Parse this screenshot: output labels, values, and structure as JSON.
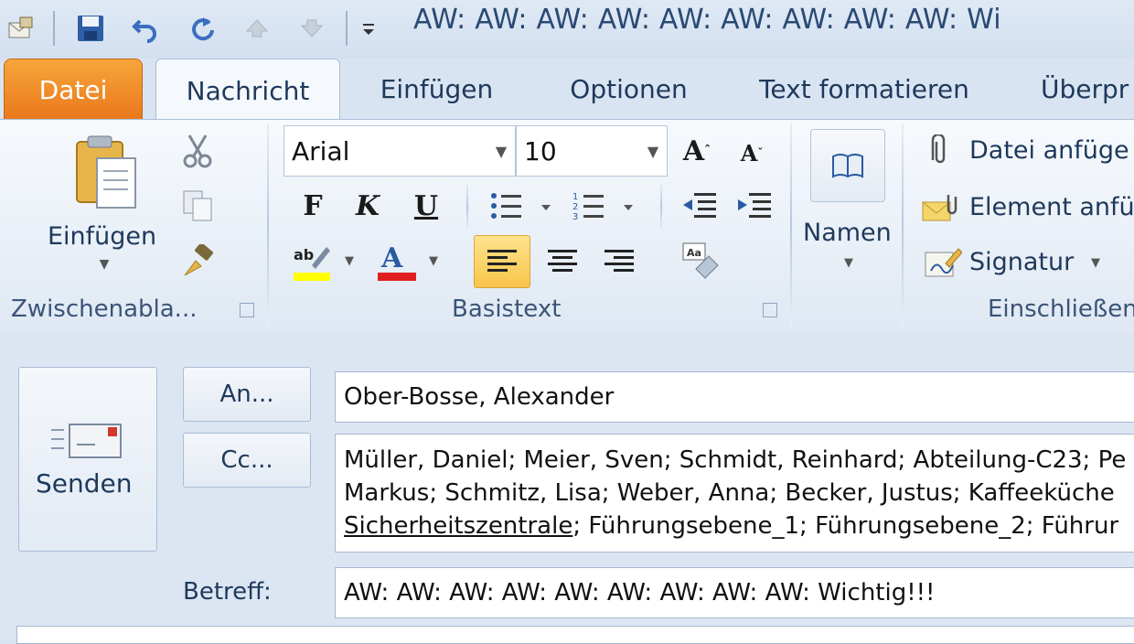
{
  "window": {
    "title": "AW: AW: AW: AW: AW: AW: AW: AW: AW: Wi"
  },
  "quick_access": {
    "icons": [
      "outlook-icon",
      "save-icon",
      "undo-icon",
      "redo-icon",
      "previous-icon",
      "next-icon",
      "customize-toolbar-icon"
    ]
  },
  "tabs": [
    {
      "label": "Datei"
    },
    {
      "label": "Nachricht"
    },
    {
      "label": "Einfügen"
    },
    {
      "label": "Optionen"
    },
    {
      "label": "Text formatieren"
    },
    {
      "label": "Überpr"
    }
  ],
  "ribbon": {
    "clipboard": {
      "paste_label": "Einfügen",
      "group_label": "Zwischenabla..."
    },
    "basic_text": {
      "font": "Arial",
      "size": "10",
      "bold": "F",
      "italic": "K",
      "underline": "U",
      "group_label": "Basistext"
    },
    "names": {
      "label": "Namen"
    },
    "include": {
      "attach_file": "Datei anfüge",
      "attach_item": "Element anfü",
      "signature": "Signatur",
      "group_label": "Einschließen"
    }
  },
  "compose": {
    "send_label": "Senden",
    "to_button": "An...",
    "cc_button": "Cc...",
    "to_value": "Ober-Bosse, Alexander",
    "cc_line1": "Müller, Daniel; Meier, Sven; Schmidt, Reinhard; Abteilung-C23; Pe",
    "cc_line2": "Markus; Schmitz, Lisa; Weber, Anna; Becker, Justus; Kaffeeküche",
    "cc_line3_link": "Sicherheitszentrale",
    "cc_line3_rest": "; Führungsebene_1; Führungsebene_2; Führur",
    "subject_label": "Betreff:",
    "subject_value": "AW: AW: AW: AW: AW: AW: AW: AW: AW: Wichtig!!!"
  },
  "colors": {
    "file_tab": "#e9771c",
    "highlight": "#ffff00",
    "font_color": "#e02020"
  }
}
